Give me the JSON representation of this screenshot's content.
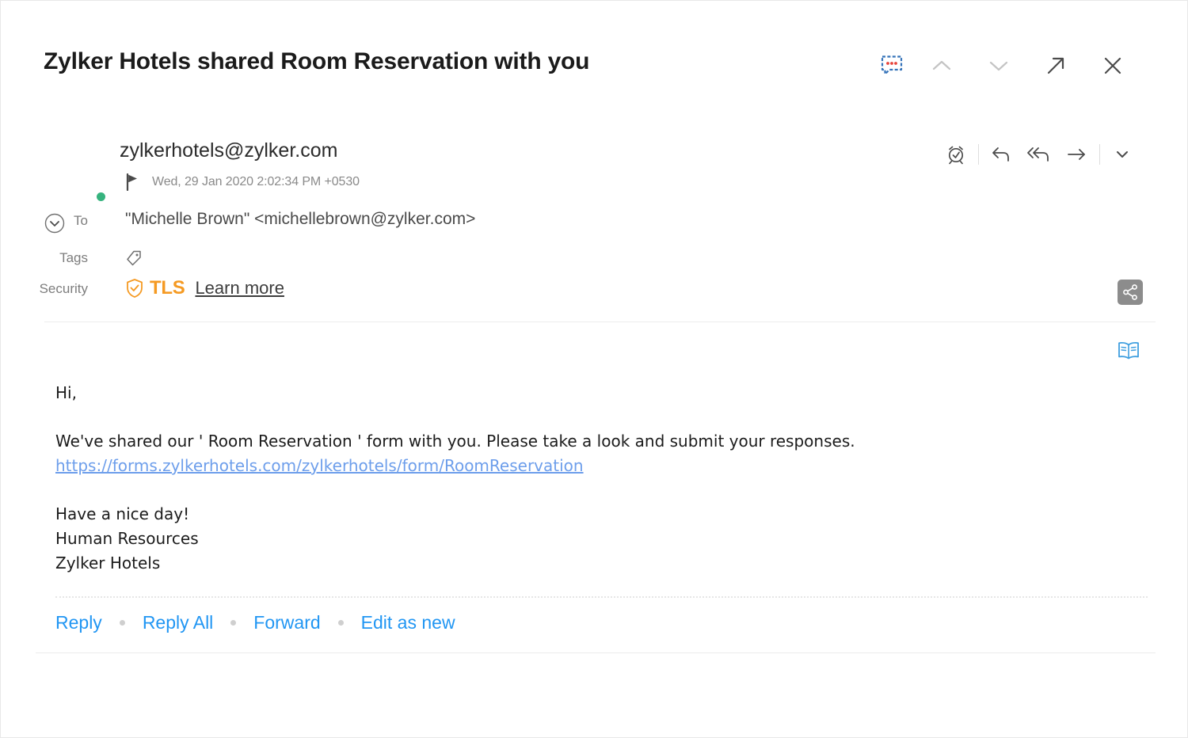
{
  "header": {
    "subject": "Zylker Hotels shared Room Reservation with you",
    "actions": [
      {
        "name": "comment-bubble-icon",
        "label": "Comments"
      },
      {
        "name": "chevron-up-icon",
        "label": "Previous message"
      },
      {
        "name": "chevron-down-icon",
        "label": "Next message"
      },
      {
        "name": "pop-out-arrow-icon",
        "label": "Open in new window"
      },
      {
        "name": "close-icon",
        "label": "Close"
      }
    ]
  },
  "message": {
    "sender_email": "zylkerhotels@zylker.com",
    "timestamp": "Wed, 29 Jan 2020 2:02:34 PM +0530",
    "presence": "online",
    "to_label": "To",
    "to_value": "\"Michelle Brown\" <michellebrown@zylker.com>",
    "tags_label": "Tags",
    "tags_value": "",
    "security_label": "Security",
    "security_badge": "TLS",
    "security_link": "Learn more",
    "detail_actions": [
      {
        "name": "snooze-clock-icon",
        "label": "Remind me"
      },
      {
        "name": "reply-icon",
        "label": "Reply"
      },
      {
        "name": "reply-all-icon",
        "label": "Reply All"
      },
      {
        "name": "forward-arrow-icon",
        "label": "Forward"
      },
      {
        "name": "more-chevron-down-icon",
        "label": "More options"
      }
    ],
    "share_action": "Share",
    "reader_action": "Reading mode"
  },
  "body": {
    "greeting": "Hi,",
    "paragraph": "We've shared our ' Room Reservation ' form with you. Please take a look and submit your responses.",
    "link": "https://forms.zylkerhotels.com/zylkerhotels/form/RoomReservation",
    "signature": [
      "Have a nice day!",
      "Human Resources",
      "Zylker Hotels"
    ]
  },
  "footer": {
    "links": [
      "Reply",
      "Reply All",
      "Forward",
      "Edit as new"
    ]
  },
  "colors": {
    "accent_blue": "#2196f3",
    "link_blue": "#6d9eeb",
    "tls_orange": "#f59a23",
    "presence_green": "#36b37e",
    "icon_grey": "#555555",
    "muted_grey": "#8a8a8a"
  }
}
